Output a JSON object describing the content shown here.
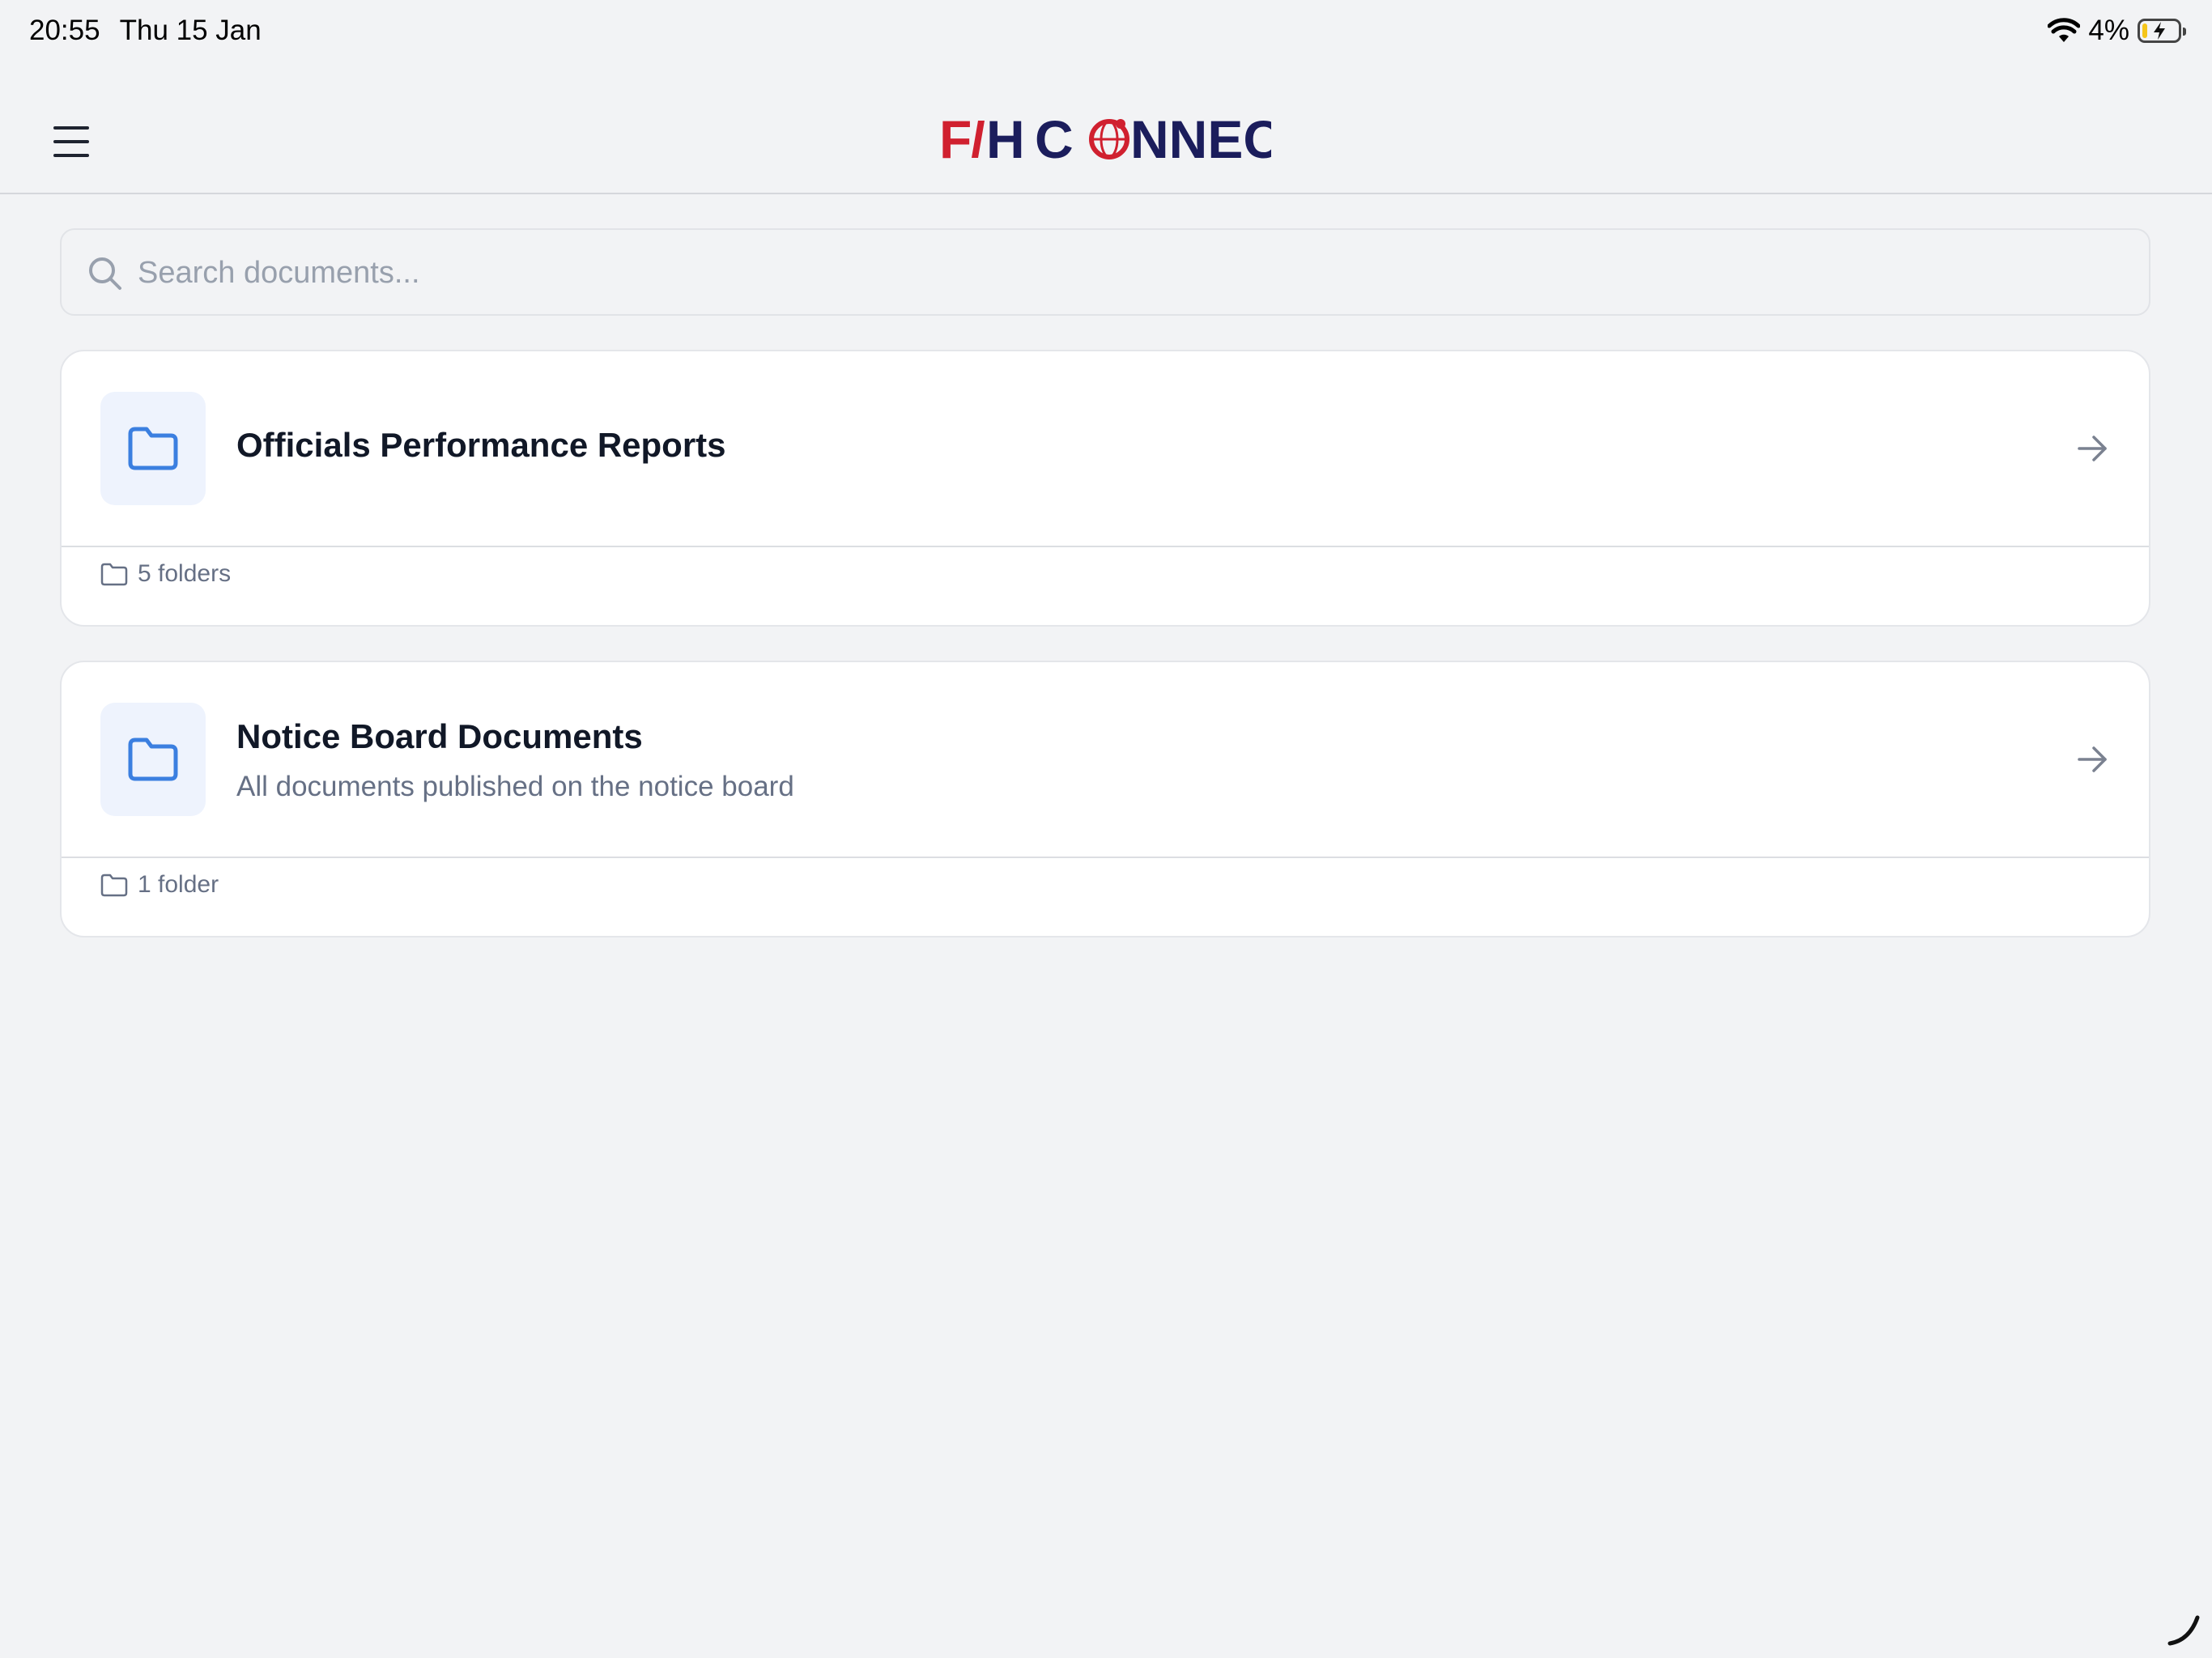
{
  "status_bar": {
    "time": "20:55",
    "date": "Thu 15 Jan",
    "battery": "4%"
  },
  "header": {
    "logo_text_red": "F",
    "logo_text_navy": "H C",
    "logo_text_end": "NNECT"
  },
  "search": {
    "placeholder": "Search documents..."
  },
  "collections": [
    {
      "title": "Officials Performance Reports",
      "subtitle": "",
      "count_label": "5 folders"
    },
    {
      "title": "Notice Board Documents",
      "subtitle": "All documents published on the notice board",
      "count_label": "1 folder"
    }
  ],
  "colors": {
    "accent": "#3b7fe0",
    "brand_red": "#d0202f",
    "brand_navy": "#1b1d5c"
  }
}
